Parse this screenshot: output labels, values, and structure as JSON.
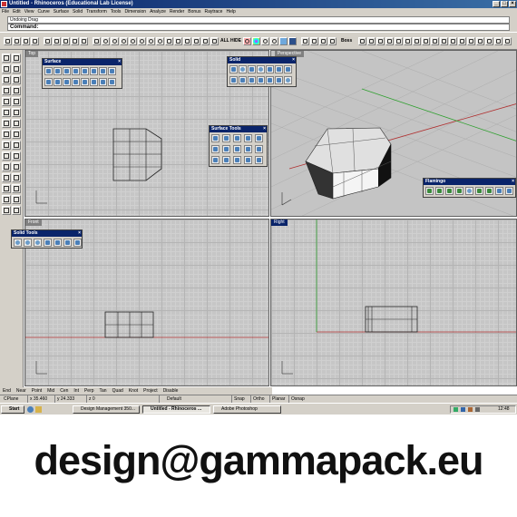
{
  "window": {
    "title": "Untitled - Rhinoceros (Educational Lab License)"
  },
  "menu": [
    "File",
    "Edit",
    "View",
    "Curve",
    "Surface",
    "Solid",
    "Transform",
    "Tools",
    "Dimension",
    "Analyze",
    "Render",
    "Bonus",
    "Raytrace",
    "Help"
  ],
  "command": {
    "history": "Undoing Drag",
    "prompt": "Command:"
  },
  "toolbar": {
    "all_label": "ALL",
    "hide_label": "HIDE",
    "boss_label": "Boss"
  },
  "viewports": {
    "top": {
      "label": "Top"
    },
    "perspective": {
      "label": "Perspective"
    },
    "front": {
      "label": "Front"
    },
    "right": {
      "label": "Right"
    }
  },
  "palettes": {
    "surface": {
      "title": "Surface"
    },
    "solid": {
      "title": "Solid"
    },
    "surface_tools": {
      "title": "Surface Tools"
    },
    "flamingo": {
      "title": "Flamingo"
    },
    "solid_tools": {
      "title": "Solid Tools"
    }
  },
  "bottom_tabs": [
    "End",
    "Near",
    "Point",
    "Mid",
    "Cen",
    "Int",
    "Perp",
    "Tan",
    "Quad",
    "Knot",
    "Project",
    "Disable"
  ],
  "status": {
    "cplane": "CPlane",
    "x": "x 35.460",
    "y": "y 24.333",
    "z": "z 0",
    "layer": "Default",
    "snap": "Snap",
    "ortho": "Ortho",
    "planar": "Planar",
    "osnap": "Osnap"
  },
  "taskbar": {
    "start": "Start",
    "tasks": [
      "Design Management 350...",
      "Untitled - Rhinoceros ...",
      "Adobe Photoshop"
    ],
    "clock": "12:48"
  },
  "footer": {
    "email": "design@gammapack.eu"
  },
  "colors": {
    "titlebar": "#0a246a",
    "viewport_bg": "#c6c6c6",
    "x_axis": "#b03030",
    "y_axis": "#30a030"
  }
}
